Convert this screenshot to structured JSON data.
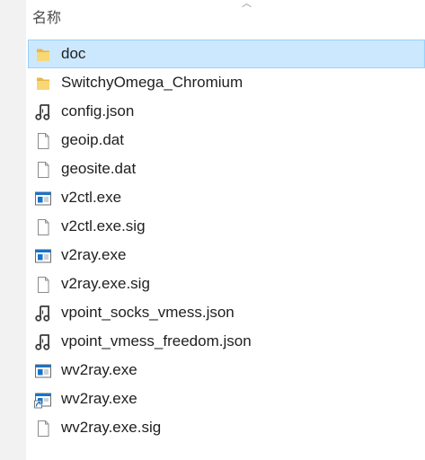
{
  "header": {
    "column_name": "名称"
  },
  "files": [
    {
      "name": "doc",
      "icon": "folder-icon",
      "selected": true
    },
    {
      "name": "SwitchyOmega_Chromium",
      "icon": "folder-icon",
      "selected": false
    },
    {
      "name": "config.json",
      "icon": "json-file-icon",
      "selected": false
    },
    {
      "name": "geoip.dat",
      "icon": "blank-file-icon",
      "selected": false
    },
    {
      "name": "geosite.dat",
      "icon": "blank-file-icon",
      "selected": false
    },
    {
      "name": "v2ctl.exe",
      "icon": "exe-file-icon",
      "selected": false
    },
    {
      "name": "v2ctl.exe.sig",
      "icon": "blank-file-icon",
      "selected": false
    },
    {
      "name": "v2ray.exe",
      "icon": "exe-file-icon",
      "selected": false
    },
    {
      "name": "v2ray.exe.sig",
      "icon": "blank-file-icon",
      "selected": false
    },
    {
      "name": "vpoint_socks_vmess.json",
      "icon": "json-file-icon",
      "selected": false
    },
    {
      "name": "vpoint_vmess_freedom.json",
      "icon": "json-file-icon",
      "selected": false
    },
    {
      "name": "wv2ray.exe",
      "icon": "exe-file-icon",
      "selected": false
    },
    {
      "name": "wv2ray.exe",
      "icon": "shortcut-icon",
      "selected": false
    },
    {
      "name": "wv2ray.exe.sig",
      "icon": "blank-file-icon",
      "selected": false
    }
  ],
  "colors": {
    "selection_background": "#cce8ff",
    "selection_border": "#99d1ff",
    "folder": "#f8d775",
    "exe_blue": "#1a73c9"
  }
}
